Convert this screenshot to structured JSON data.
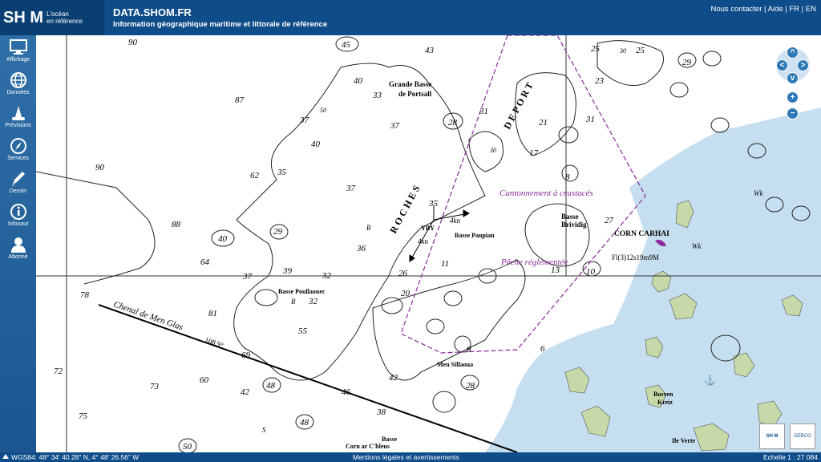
{
  "header": {
    "logo": "SH  M",
    "logo_tagline_1": "L'océan",
    "logo_tagline_2": "en référence",
    "title": "DATA.SHOM.FR",
    "subtitle": "Information géographique maritime et littorale de référence",
    "links": {
      "contact": "Nous contacter",
      "help": "Aide",
      "fr": "FR",
      "en": "EN",
      "sep": " | "
    }
  },
  "sidebar": {
    "items": [
      {
        "label": "Affichage",
        "icon": "monitor-icon"
      },
      {
        "label": "Données",
        "icon": "globe-icon"
      },
      {
        "label": "Prévisions",
        "icon": "buoy-icon"
      },
      {
        "label": "Services",
        "icon": "compass-icon"
      },
      {
        "label": "Dessin",
        "icon": "pencil-icon"
      },
      {
        "label": "Infonaut",
        "icon": "info-icon"
      },
      {
        "label": "Abonné",
        "icon": "user-icon"
      }
    ]
  },
  "map": {
    "labels": {
      "grande_basse": "Grande Basse",
      "de_portsall": "de Portsall",
      "roches": "R O C H E S",
      "de_port": "D E   P O R T",
      "cantonnement": "Cantonnement à crustacés",
      "peche": "Pêche réglementée",
      "basse_brividig_1": "Basse",
      "basse_brividig_2": "Brividig",
      "corn_carhai": "CORN CARHAI",
      "light": "Fl(3)12s19m9M",
      "basse_paupian": "Basse Paupian",
      "yby": "YBY",
      "four_kn_a": "4kn",
      "four_kn_b": "4kn",
      "basse_poullaouec": "Basse Poullaouec",
      "chenal": "Chenal de Men Glas",
      "bearing": "108,9°",
      "men_sillaoua": "Men Sillaoua",
      "bosven_1": "Bosven",
      "bosven_2": "Kreiz",
      "ile_verte": "Ile Verte",
      "basse_bottom": "Basse",
      "corn_ar_chleus": "Corn ar C'hleus",
      "wk1": "Wk",
      "wk2": "Wk",
      "r1": "R",
      "r2": "R",
      "s1": "S"
    },
    "depths": [
      {
        "v": "90"
      },
      {
        "v": "45"
      },
      {
        "v": "43"
      },
      {
        "v": "40"
      },
      {
        "v": "33"
      },
      {
        "v": "87"
      },
      {
        "v": "50"
      },
      {
        "v": "37"
      },
      {
        "v": "37"
      },
      {
        "v": "40"
      },
      {
        "v": "90"
      },
      {
        "v": "62"
      },
      {
        "v": "35"
      },
      {
        "v": "37"
      },
      {
        "v": "88"
      },
      {
        "v": "40"
      },
      {
        "v": "29"
      },
      {
        "v": "36"
      },
      {
        "v": "64"
      },
      {
        "v": "39"
      },
      {
        "v": "37"
      },
      {
        "v": "32"
      },
      {
        "v": "26"
      },
      {
        "v": "78"
      },
      {
        "v": "81"
      },
      {
        "v": "32"
      },
      {
        "v": "55"
      },
      {
        "v": "69"
      },
      {
        "v": "72"
      },
      {
        "v": "73"
      },
      {
        "v": "60"
      },
      {
        "v": "42"
      },
      {
        "v": "48"
      },
      {
        "v": "46"
      },
      {
        "v": "42"
      },
      {
        "v": "75"
      },
      {
        "v": "38"
      },
      {
        "v": "48"
      },
      {
        "v": "50"
      },
      {
        "v": "28"
      },
      {
        "v": "31"
      },
      {
        "v": "21"
      },
      {
        "v": "30"
      },
      {
        "v": "31"
      },
      {
        "v": "25"
      },
      {
        "v": "30"
      },
      {
        "v": "25"
      },
      {
        "v": "29"
      },
      {
        "v": "23"
      },
      {
        "v": "20"
      },
      {
        "v": "17"
      },
      {
        "v": "11"
      },
      {
        "v": "9"
      },
      {
        "v": "13"
      },
      {
        "v": "8"
      },
      {
        "v": "10"
      },
      {
        "v": "27"
      },
      {
        "v": "35"
      },
      {
        "v": "28"
      },
      {
        "v": "6"
      }
    ]
  },
  "nav": {
    "up": "^",
    "left": "<",
    "right": ">",
    "down": "v",
    "zoom_in": "+",
    "zoom_out": "−"
  },
  "footer": {
    "coords": "WGS84: 48° 34' 40.28\" N, 4° 48' 26.56\" W",
    "legal": "Mentions légales et avertissements",
    "scale": "Echelle 1 : 27 084",
    "logo1": "SH  M",
    "logo2": "GEBCO"
  },
  "colors": {
    "header": "#0f4d8a",
    "sidebar": "#1b5691",
    "shallow": "#c5dff0",
    "land": "#c7d9a8",
    "purple": "#8a2a9a"
  }
}
